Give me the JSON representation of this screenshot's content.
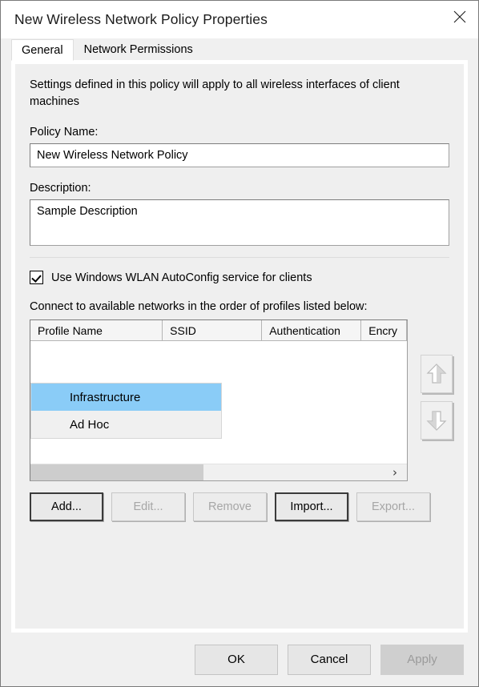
{
  "window": {
    "title": "New Wireless Network Policy Properties",
    "close_icon": "close-icon"
  },
  "tabs": [
    {
      "label": "General",
      "active": true
    },
    {
      "label": "Network Permissions",
      "active": false
    }
  ],
  "general": {
    "intro": "Settings defined in this policy will apply to all wireless interfaces of client machines",
    "policy_name_label": "Policy Name:",
    "policy_name_value": "New Wireless Network Policy",
    "description_label": "Description:",
    "description_value": "Sample Description",
    "autoconfig_checkbox_label": "Use Windows WLAN AutoConfig service for clients",
    "autoconfig_checked": true,
    "list_label": "Connect to available networks in the order of profiles listed below:"
  },
  "profile_list": {
    "columns": [
      {
        "label": "Profile Name",
        "width": 176
      },
      {
        "label": "SSID",
        "width": 132
      },
      {
        "label": "Authentication",
        "width": 132
      },
      {
        "label": "Encry",
        "width": 60
      }
    ],
    "rows": [],
    "scroll_right_arrow": "›"
  },
  "order_buttons": [
    {
      "name": "move-up-button",
      "label": "Move Up"
    },
    {
      "name": "move-down-button",
      "label": "Move Down"
    }
  ],
  "dropdown": {
    "items": [
      {
        "label": "Infrastructure",
        "selected": true
      },
      {
        "label": "Ad Hoc",
        "selected": false
      }
    ],
    "highlight_color": "#8accf7"
  },
  "action_buttons": [
    {
      "label": "Add...",
      "enabled": true,
      "primary": true
    },
    {
      "label": "Edit...",
      "enabled": false,
      "primary": false
    },
    {
      "label": "Remove",
      "enabled": false,
      "primary": false
    },
    {
      "label": "Import...",
      "enabled": true,
      "primary": true
    },
    {
      "label": "Export...",
      "enabled": false,
      "primary": false
    }
  ],
  "footer_buttons": [
    {
      "label": "OK",
      "enabled": true
    },
    {
      "label": "Cancel",
      "enabled": true
    },
    {
      "label": "Apply",
      "enabled": false
    }
  ]
}
